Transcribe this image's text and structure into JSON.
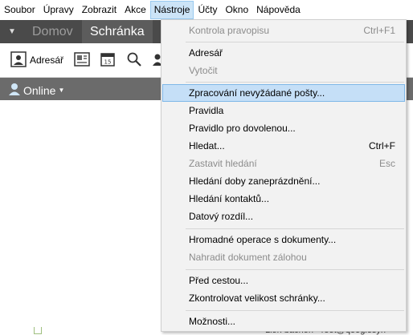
{
  "menubar": {
    "items": [
      {
        "label": "Soubor"
      },
      {
        "label": "Úpravy"
      },
      {
        "label": "Zobrazit"
      },
      {
        "label": "Akce"
      },
      {
        "label": "Nástroje"
      },
      {
        "label": "Účty"
      },
      {
        "label": "Okno"
      },
      {
        "label": "Nápověda"
      }
    ],
    "active_index": 4
  },
  "tabs": {
    "items": [
      {
        "label": "Domov"
      },
      {
        "label": "Schránka"
      }
    ],
    "selected_index": 1
  },
  "toolbar": {
    "address_book_label": "Adresář",
    "icons": [
      "address-book-icon",
      "contact-card-icon",
      "calendar-icon",
      "search-icon",
      "person-icon"
    ]
  },
  "status_bar": {
    "online_label": "Online"
  },
  "background": {
    "peek_text": "Lion bacnon - root@qooglesyn"
  },
  "dropdown": {
    "items": [
      {
        "label": "Kontrola pravopisu",
        "shortcut": "Ctrl+F1",
        "disabled": true
      },
      {
        "label": "Adresář",
        "shortcut": "",
        "disabled": false
      },
      {
        "label": "Vytočit",
        "shortcut": "",
        "disabled": true
      },
      {
        "label": "Zpracování nevyžádané pošty...",
        "shortcut": "",
        "disabled": false,
        "highlighted": true
      },
      {
        "label": "Pravidla",
        "shortcut": "",
        "disabled": false
      },
      {
        "label": "Pravidlo pro dovolenou...",
        "shortcut": "",
        "disabled": false
      },
      {
        "label": "Hledat...",
        "shortcut": "Ctrl+F",
        "disabled": false
      },
      {
        "label": "Zastavit hledání",
        "shortcut": "Esc",
        "disabled": true
      },
      {
        "label": "Hledání doby zaneprázdnění...",
        "shortcut": "",
        "disabled": false
      },
      {
        "label": "Hledání kontaktů...",
        "shortcut": "",
        "disabled": false
      },
      {
        "label": "Datový rozdíl...",
        "shortcut": "",
        "disabled": false
      },
      {
        "label": "Hromadné operace s dokumenty...",
        "shortcut": "",
        "disabled": false
      },
      {
        "label": "Nahradit dokument zálohou",
        "shortcut": "",
        "disabled": true
      },
      {
        "label": "Před cestou...",
        "shortcut": "",
        "disabled": false
      },
      {
        "label": "Zkontrolovat velikost schránky...",
        "shortcut": "",
        "disabled": false
      },
      {
        "label": "Možnosti...",
        "shortcut": "",
        "disabled": false
      }
    ]
  },
  "colors": {
    "menu_highlight": "#c5dff7",
    "tabbar_bg": "#4a4a4a",
    "status_bar_bg": "#6b6b6b"
  }
}
